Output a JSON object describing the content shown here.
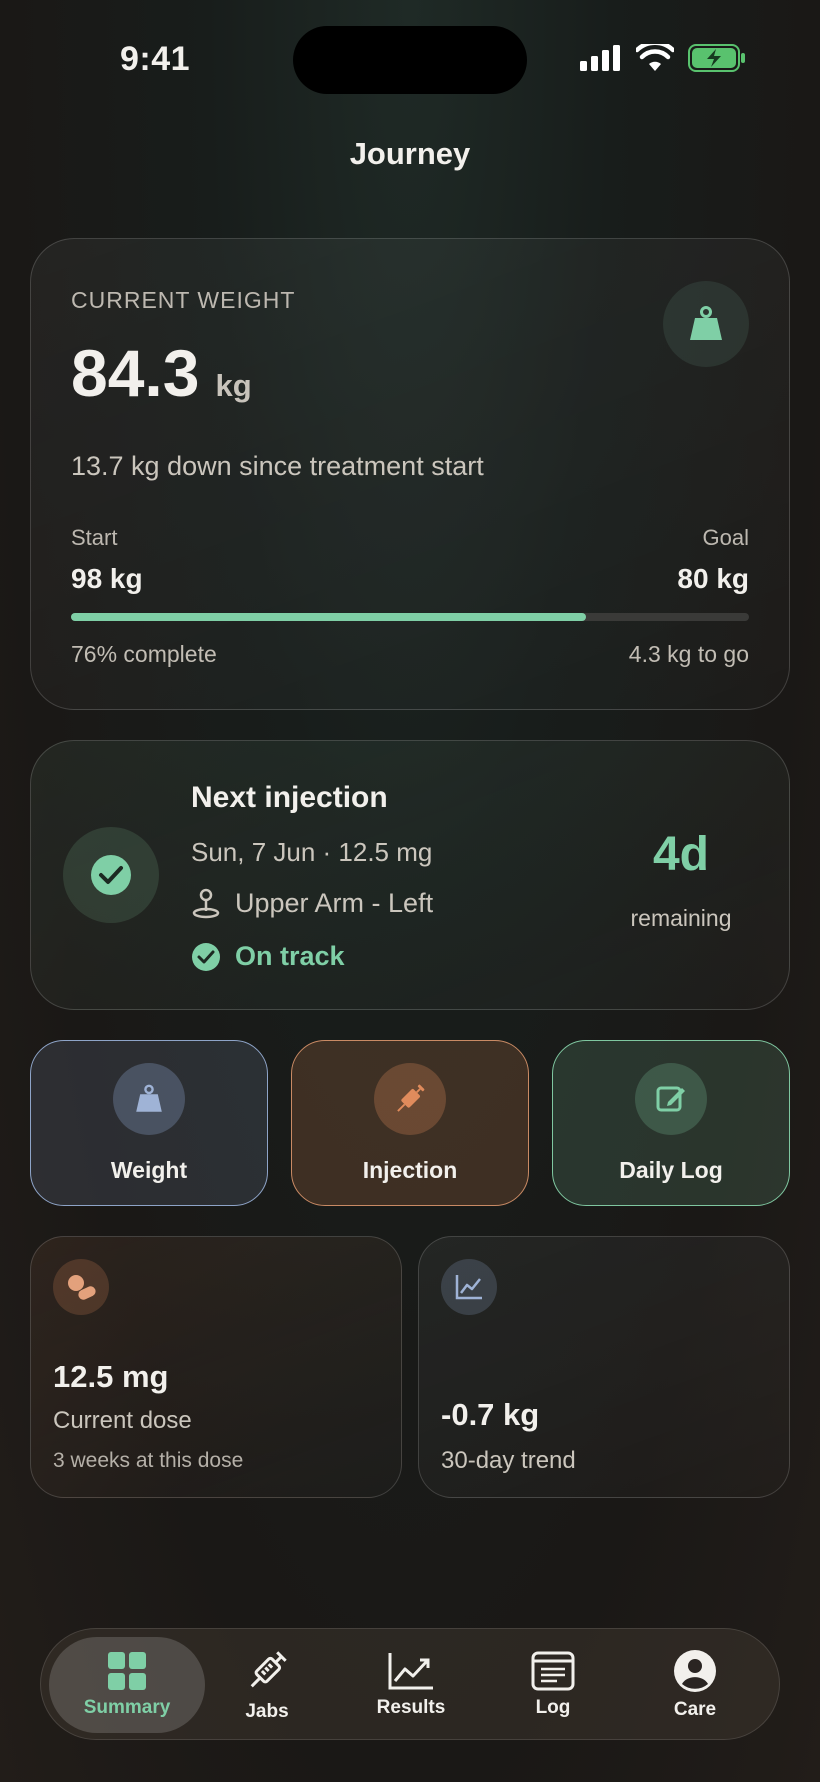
{
  "status_bar": {
    "time": "9:41"
  },
  "header": {
    "title": "Journey"
  },
  "weight_card": {
    "label": "CURRENT WEIGHT",
    "value": "84.3",
    "unit": "kg",
    "summary": "13.7 kg down since treatment start",
    "start_label": "Start",
    "start_value": "98 kg",
    "goal_label": "Goal",
    "goal_value": "80 kg",
    "progress_fraction": 0.76,
    "percent_text": "76% complete",
    "to_go_text": "4.3 kg to go",
    "icon": "weight-icon"
  },
  "injection_card": {
    "title": "Next injection",
    "date_dose": "Sun, 7 Jun · 12.5 mg",
    "site": "Upper Arm - Left",
    "status": "On track",
    "days": "4d",
    "days_label": "remaining"
  },
  "actions": [
    {
      "label": "Weight",
      "icon": "weight-icon"
    },
    {
      "label": "Injection",
      "icon": "syringe-icon"
    },
    {
      "label": "Daily Log",
      "icon": "edit-icon"
    }
  ],
  "stats": {
    "dose": {
      "value": "12.5 mg",
      "label": "Current dose",
      "sub": "3 weeks at this dose",
      "icon": "pills-icon"
    },
    "trend": {
      "value": "-0.7 kg",
      "label": "30-day trend",
      "icon": "trend-chart-icon"
    }
  },
  "tabs": [
    {
      "label": "Summary",
      "icon": "grid-icon",
      "active": true
    },
    {
      "label": "Jabs",
      "icon": "syringe-icon"
    },
    {
      "label": "Results",
      "icon": "chart-icon"
    },
    {
      "label": "Log",
      "icon": "document-icon"
    },
    {
      "label": "Care",
      "icon": "person-icon"
    }
  ],
  "colors": {
    "accent_green": "#7fcfa6",
    "weight_blue": "#8ea4c8",
    "injection_orange": "#c98a64"
  }
}
